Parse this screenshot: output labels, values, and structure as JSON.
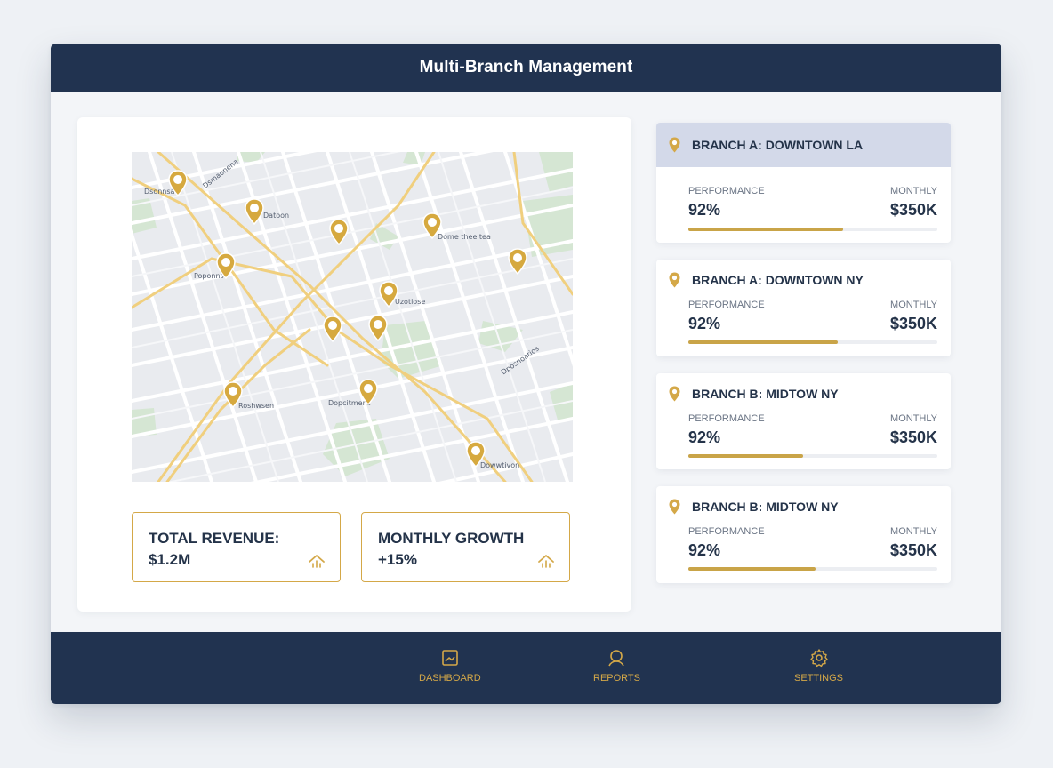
{
  "app": {
    "title": "Multi-Branch Management"
  },
  "map": {
    "labels": [
      "Dsonnsa",
      "Dsmaonena",
      "Datoon",
      "Dome thee tea",
      "Poponns",
      "Uzotiose",
      "Dposnoatios",
      "Roshwsen",
      "Dopcitmens",
      "Dowwtivon"
    ]
  },
  "stats": [
    {
      "label": "TOTAL REVENUE:",
      "value": "$1.2M",
      "icon": "trend-up-icon"
    },
    {
      "label": "MONTHLY GROWTH",
      "value": "+15%",
      "icon": "trend-up-icon"
    }
  ],
  "branches": [
    {
      "name": "BRANCH A: DOWNTOWN LA",
      "performance_label": "PERFORMANCE",
      "performance": "92%",
      "monthly_label": "MONTHLY",
      "monthly": "$350K",
      "progress": 0.62
    },
    {
      "name": "BRANCH A: DOWNTOWN NY",
      "performance_label": "PERFORMANCE",
      "performance": "92%",
      "monthly_label": "MONTHLY",
      "monthly": "$350K",
      "progress": 0.6
    },
    {
      "name": "BRANCH B: MIDTOW NY",
      "performance_label": "PERFORMANCE",
      "performance": "92%",
      "monthly_label": "MONTHLY",
      "monthly": "$350K",
      "progress": 0.46
    },
    {
      "name": "BRANCH B: MIDTOW NY",
      "performance_label": "PERFORMANCE",
      "performance": "92%",
      "monthly_label": "MONTHLY",
      "monthly": "$350K",
      "progress": 0.51
    }
  ],
  "nav": [
    {
      "label": "DASHBOARD",
      "icon": "image-frame-icon"
    },
    {
      "label": "REPORTS",
      "icon": "user-icon"
    },
    {
      "label": "SETTINGS",
      "icon": "gear-icon"
    }
  ],
  "colors": {
    "navy": "#213350",
    "gold": "#d4a848",
    "active_card": "#d3d9e9"
  }
}
